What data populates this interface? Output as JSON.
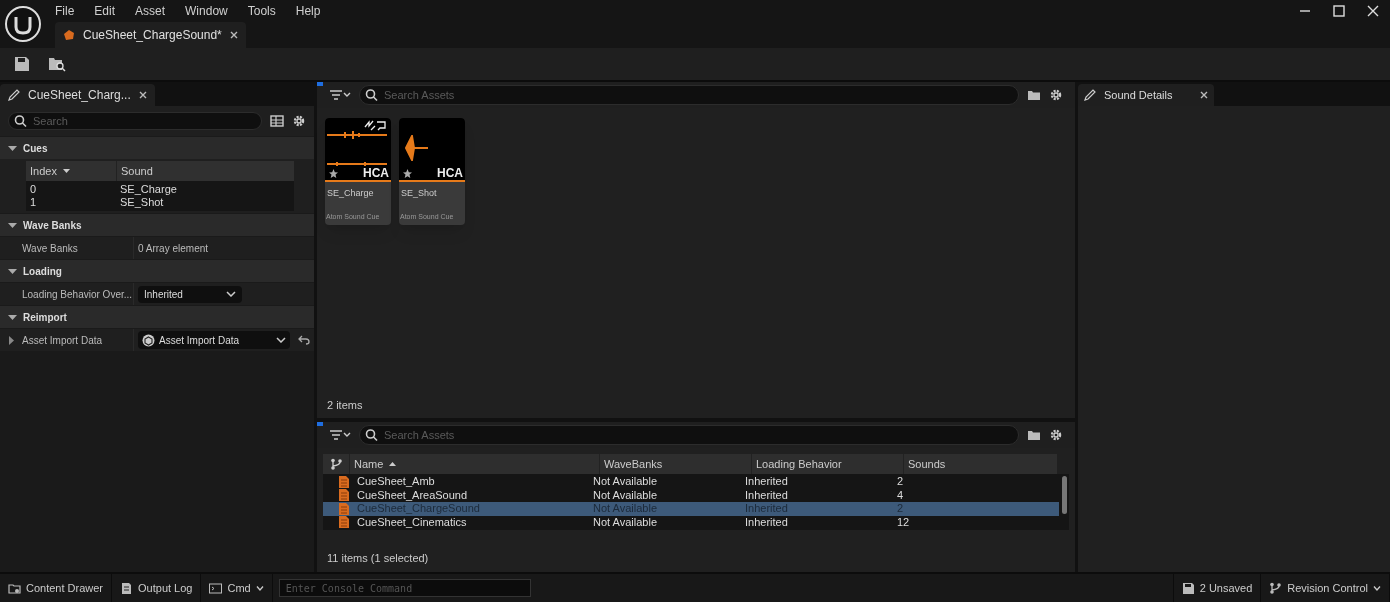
{
  "menu": [
    "File",
    "Edit",
    "Asset",
    "Window",
    "Tools",
    "Help"
  ],
  "document_tab": {
    "title": "CueSheet_ChargeSound*"
  },
  "details_panel": {
    "tab": "CueSheet_Charg...",
    "search": {
      "placeholder": "Search"
    },
    "sections": [
      {
        "title": "Cues",
        "expanded": true,
        "kind": "table",
        "columns": [
          {
            "label": "Index",
            "sorted": true
          },
          {
            "label": "Sound",
            "sorted": false
          }
        ],
        "rows": [
          [
            "0",
            "SE_Charge"
          ],
          [
            "1",
            "SE_Shot"
          ]
        ]
      },
      {
        "title": "Wave Banks",
        "expanded": true,
        "kind": "text",
        "label": "Wave Banks",
        "value": "0 Array element"
      },
      {
        "title": "Loading",
        "expanded": true,
        "kind": "dropdown",
        "label": "Loading Behavior Over...",
        "value": "Inherited"
      },
      {
        "title": "Reimport",
        "expanded": true,
        "kind": "asset",
        "label": "Asset Import Data",
        "value": "Asset Import Data",
        "row_expanded": false
      }
    ]
  },
  "asset_view": {
    "search": {
      "placeholder": "Search Assets"
    },
    "assets": [
      {
        "name": "SE_Charge",
        "type": "Atom Sound Cue",
        "badge": "HCA",
        "kind": "loop"
      },
      {
        "name": "SE_Shot",
        "type": "Atom Sound Cue",
        "badge": "HCA",
        "kind": "oneshot"
      }
    ],
    "count": "2 items"
  },
  "list_view": {
    "search": {
      "placeholder": "Search Assets"
    },
    "columns": [
      {
        "label": "Name",
        "sorted": true
      },
      {
        "label": "WaveBanks",
        "sorted": false
      },
      {
        "label": "Loading Behavior",
        "sorted": false
      },
      {
        "label": "Sounds",
        "sorted": false
      }
    ],
    "rows": [
      {
        "cells": [
          "CueSheet_Amb",
          "Not Available",
          "Inherited",
          "2"
        ],
        "selected": false
      },
      {
        "cells": [
          "CueSheet_AreaSound",
          "Not Available",
          "Inherited",
          "4"
        ],
        "selected": false
      },
      {
        "cells": [
          "CueSheet_ChargeSound",
          "Not Available",
          "Inherited",
          "2"
        ],
        "selected": true
      },
      {
        "cells": [
          "CueSheet_Cinematics",
          "Not Available",
          "Inherited",
          "12"
        ],
        "selected": false
      }
    ],
    "count": "11 items (1 selected)"
  },
  "sound_details": {
    "tab": "Sound Details"
  },
  "status_bar": {
    "left": [
      {
        "label": "Content Drawer",
        "kind": "drawer"
      },
      {
        "label": "Output Log",
        "kind": "log"
      },
      {
        "label": "Cmd",
        "kind": "cmd"
      }
    ],
    "console": {
      "placeholder": "Enter Console Command"
    },
    "right": [
      {
        "label": "2 Unsaved",
        "kind": "save"
      },
      {
        "label": "Revision Control",
        "kind": "branch"
      }
    ]
  }
}
